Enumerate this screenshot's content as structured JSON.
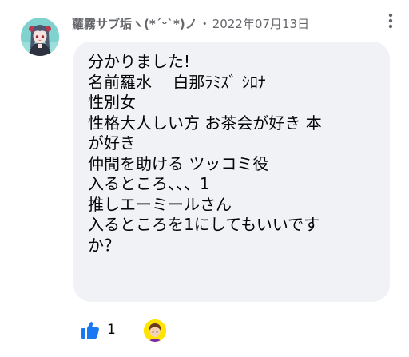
{
  "comment": {
    "author": "蘿霧サブ垢ヽ(*´ᵕ`*)ノ",
    "separator": "・",
    "date": "2022年07月13日",
    "lines": [
      "分かりました!",
      "名前羅水　 白那ﾗﾐｽﾞ ｼﾛﾅ",
      "性別女",
      "性格大人しい方 お茶会が好き 本",
      "が好き",
      "仲間を助ける ツッコミ役",
      "入るところ、、、1",
      "推しエーミールさん",
      "入るところを1にしてもいいです",
      "か？"
    ]
  },
  "reactions": {
    "icon": "thumbs-up-icon",
    "like_count": "1",
    "like_color": "#1877f2"
  },
  "colors": {
    "bubble": "#f0f2f5",
    "meta_text": "#65676b",
    "body_text": "#050505"
  }
}
